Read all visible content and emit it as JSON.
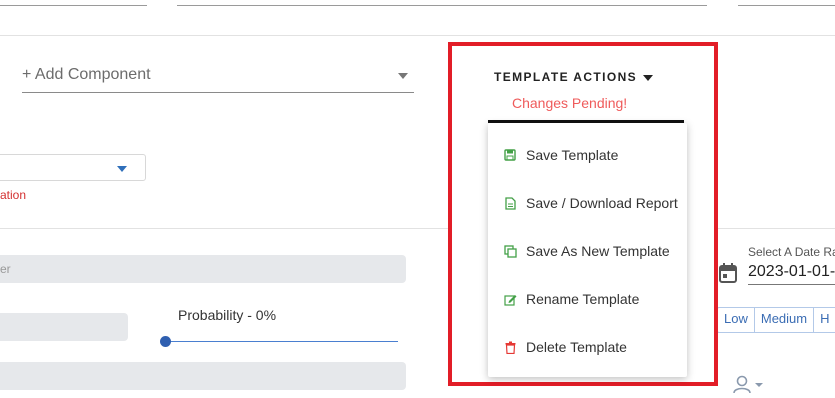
{
  "form": {
    "add_component_label": "+ Add Component",
    "validation_fragment": "ation",
    "field_placeholder_fragment": "er",
    "probability_label": "Probability - 0%",
    "probability_value": 0
  },
  "template_actions": {
    "title": "TEMPLATE ACTIONS",
    "status": "Changes Pending!",
    "menu": [
      {
        "label": "Save Template",
        "icon": "save-icon",
        "color": "#43a047"
      },
      {
        "label": "Save / Download Report",
        "icon": "document-icon",
        "color": "#43a047"
      },
      {
        "label": "Save As New Template",
        "icon": "copy-icon",
        "color": "#43a047"
      },
      {
        "label": "Rename Template",
        "icon": "edit-icon",
        "color": "#43a047"
      },
      {
        "label": "Delete Template",
        "icon": "trash-icon",
        "color": "#e53935"
      }
    ]
  },
  "date_range": {
    "label": "Select A Date Ra",
    "value": "2023-01-01-"
  },
  "priority": [
    "Low",
    "Medium",
    "H"
  ],
  "colors": {
    "highlight_border": "#e21d27",
    "pending_text": "#ef5b5b",
    "error_text": "#d32f2f",
    "accent_blue": "#3b6db4"
  }
}
